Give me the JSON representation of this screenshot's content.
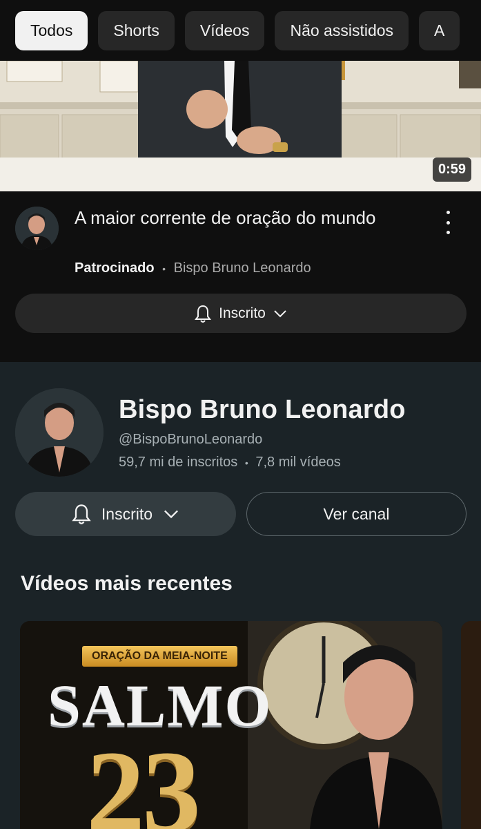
{
  "chips": [
    {
      "label": "Todos",
      "active": true
    },
    {
      "label": "Shorts",
      "active": false
    },
    {
      "label": "Vídeos",
      "active": false
    },
    {
      "label": "Não assistidos",
      "active": false
    },
    {
      "label": "A",
      "active": false
    }
  ],
  "ad": {
    "duration": "0:59",
    "title": "A maior corrente de oração do mundo",
    "sponsored_label": "Patrocinado",
    "separator": "•",
    "channel": "Bispo Bruno Leonardo",
    "subscribe_label": "Inscrito"
  },
  "channel": {
    "name": "Bispo Bruno Leonardo",
    "handle": "@BispoBrunoLeonardo",
    "subscribers": "59,7 mi de inscritos",
    "separator": "•",
    "videos": "7,8 mil vídeos",
    "subscribe_label": "Inscrito",
    "view_channel_label": "Ver canal"
  },
  "recent": {
    "title": "Vídeos mais recentes",
    "video": {
      "banner": "ORAÇÃO DA MEIA-NOITE",
      "headline": "SALMO",
      "number": "23"
    }
  },
  "colors": {
    "background": "#0f0f0f",
    "chip": "#272727",
    "chip_active": "#f1f1f1",
    "channel_bg": "#1b2327",
    "gold": "#e0b862"
  },
  "icons": [
    "bell-icon",
    "chevron-down-icon",
    "more-vert-icon"
  ]
}
